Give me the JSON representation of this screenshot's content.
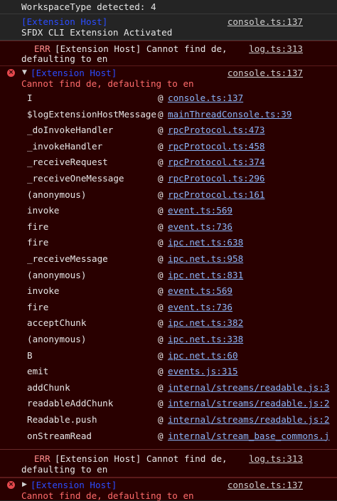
{
  "top_partial": {
    "text": "WorkspaceType detected: 4"
  },
  "msg1": {
    "prefix": "[Extension Host]",
    "text": "SFDX CLI Extension Activated",
    "source": "console.ts:137"
  },
  "err1": {
    "tag": "ERR",
    "line1": "[Extension Host] Cannot find de,",
    "line2": "defaulting to en",
    "source": "log.ts:313"
  },
  "err2": {
    "badge": "×",
    "caret": "▼",
    "prefix": "[Extension Host]",
    "message": "Cannot find de, defaulting to en",
    "source": "console.ts:137",
    "stack": [
      {
        "fn": "I",
        "loc": "console.ts:137"
      },
      {
        "fn": "$logExtensionHostMessage",
        "loc": "mainThreadConsole.ts:39"
      },
      {
        "fn": "_doInvokeHandler",
        "loc": "rpcProtocol.ts:473"
      },
      {
        "fn": "_invokeHandler",
        "loc": "rpcProtocol.ts:458"
      },
      {
        "fn": "_receiveRequest",
        "loc": "rpcProtocol.ts:374"
      },
      {
        "fn": "_receiveOneMessage",
        "loc": "rpcProtocol.ts:296"
      },
      {
        "fn": "(anonymous)",
        "loc": "rpcProtocol.ts:161"
      },
      {
        "fn": "invoke",
        "loc": "event.ts:569"
      },
      {
        "fn": "fire",
        "loc": "event.ts:736"
      },
      {
        "fn": "fire",
        "loc": "ipc.net.ts:638"
      },
      {
        "fn": "_receiveMessage",
        "loc": "ipc.net.ts:958"
      },
      {
        "fn": "(anonymous)",
        "loc": "ipc.net.ts:831"
      },
      {
        "fn": "invoke",
        "loc": "event.ts:569"
      },
      {
        "fn": "fire",
        "loc": "event.ts:736"
      },
      {
        "fn": "acceptChunk",
        "loc": "ipc.net.ts:382"
      },
      {
        "fn": "(anonymous)",
        "loc": "ipc.net.ts:338"
      },
      {
        "fn": "B",
        "loc": "ipc.net.ts:60"
      },
      {
        "fn": "emit",
        "loc": "events.js:315"
      },
      {
        "fn": "addChunk",
        "loc": "internal/streams/readable.js:3"
      },
      {
        "fn": "readableAddChunk",
        "loc": "internal/streams/readable.js:2"
      },
      {
        "fn": "Readable.push",
        "loc": "internal/streams/readable.js:2"
      },
      {
        "fn": "onStreamRead",
        "loc": "internal/stream_base_commons.j"
      }
    ],
    "at": "@"
  },
  "err3": {
    "tag": "ERR",
    "line1": "[Extension Host] Cannot find de,",
    "line2": "defaulting to en",
    "source": "log.ts:313"
  },
  "err4": {
    "badge": "×",
    "caret": "▶",
    "prefix": "[Extension Host]",
    "message": "Cannot find de, defaulting to en",
    "source": "console.ts:137"
  }
}
